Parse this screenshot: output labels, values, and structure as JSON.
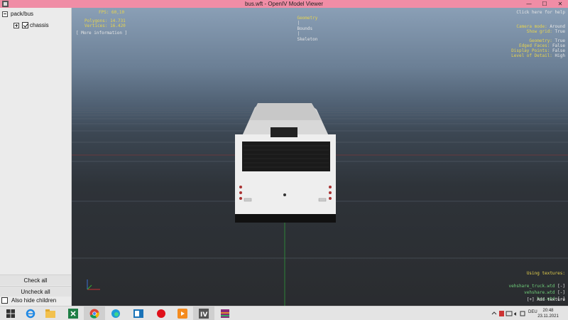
{
  "window": {
    "title": "bus.wft - OpenIV Model Viewer",
    "controls": {
      "minimize": "—",
      "maximize": "☐",
      "close": "✕"
    }
  },
  "sidebar": {
    "tree": {
      "root_label": "pack/bus",
      "child_label": "chassis",
      "child_checked": true
    },
    "check_all_label": "Check all",
    "uncheck_all_label": "Uncheck all",
    "also_hide_children_label": "Also hide children",
    "also_hide_children_checked": false
  },
  "viewport": {
    "stats": {
      "fps": "FPS: 60,10",
      "polygons": "Polygons: 14.731",
      "vertices": "Vertices: 16.420"
    },
    "more_information": "[ More information ]",
    "view_tabs": [
      "Geometry",
      "Bounds",
      "Skeleton"
    ],
    "view_tab_separator": "|",
    "active_view_tab": "Geometry",
    "help_hint": "Click here for help",
    "camera": {
      "mode_label": "Camera mode:",
      "mode_value": "Around",
      "grid_label": "Show grid:",
      "grid_value": "True"
    },
    "render_settings": [
      {
        "label": "Geometry:",
        "value": "True"
      },
      {
        "label": "Edged Faces:",
        "value": "False"
      },
      {
        "label": "Display Points:",
        "value": "False"
      },
      {
        "label": "Level of Detail:",
        "value": "High"
      }
    ],
    "textures": {
      "header": "Using textures:",
      "items": [
        {
          "name": "vehshare_truck.wtd",
          "action": "[-]"
        },
        {
          "name": "vehshare.wtd",
          "action": "[-]"
        },
        {
          "name": "bus.wtd",
          "action": "[-]"
        }
      ],
      "add_label": "[+] Add texture"
    },
    "colors": {
      "hud_yellow": "#e8d44d",
      "hud_green": "#6fd07a",
      "accent_tab": "#d8c860"
    }
  },
  "taskbar": {
    "apps": [
      "windows-start-icon",
      "internet-explorer-icon",
      "file-explorer-icon",
      "excel-icon",
      "chrome-icon",
      "edge-icon",
      "photos-icon",
      "red-record-icon",
      "media-player-icon",
      "openiv-icon",
      "winrar-icon"
    ],
    "tray": {
      "language": "DEU"
    },
    "clock": {
      "time": "20:48",
      "date": "23.11.2021"
    }
  }
}
